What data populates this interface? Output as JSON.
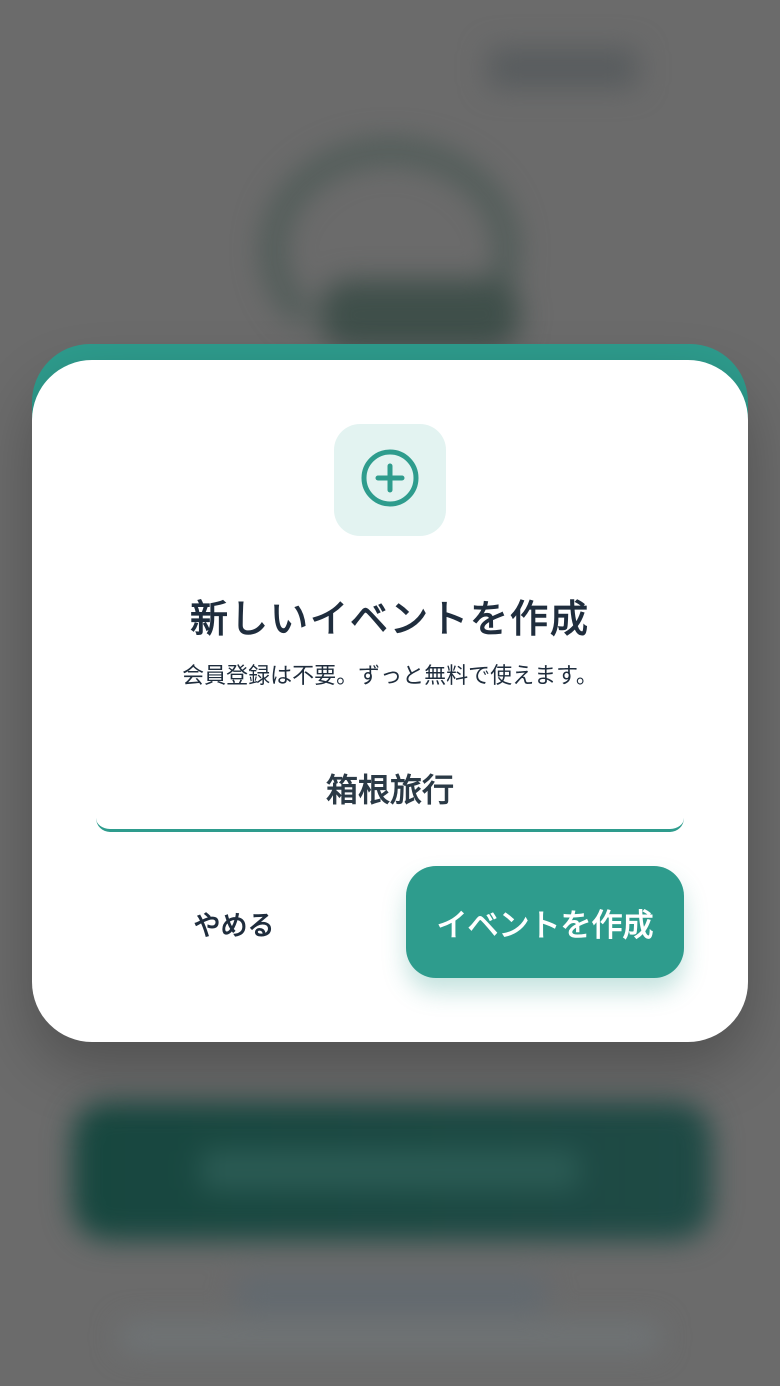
{
  "dialog": {
    "title": "新しいイベントを作成",
    "subtitle": "会員登録は不要。ずっと無料で使えます。",
    "icon": "plus-circle-icon",
    "event_name_value": "箱根旅行",
    "cancel_label": "やめる",
    "create_label": "イベントを作成"
  },
  "colors": {
    "accent": "#2e9c8d",
    "icon_tile_bg": "#e3f3f1",
    "text": "#1f2d3d",
    "overlay": "#6b6b6b"
  }
}
